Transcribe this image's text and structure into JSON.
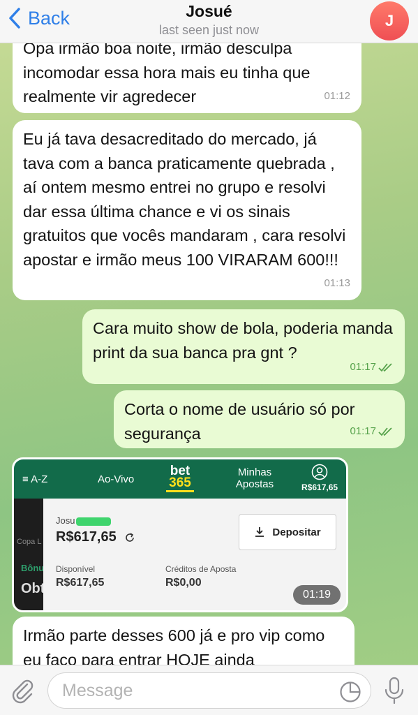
{
  "header": {
    "back_label": "Back",
    "contact_name": "Josué",
    "status": "last seen just now",
    "avatar_initial": "J"
  },
  "messages": [
    {
      "direction": "in",
      "text": "Opa irmão boa noite, irmão desculpa incomodar essa hora mais eu tinha que realmente vir agredecer",
      "time": "01:12"
    },
    {
      "direction": "in",
      "text": "Eu já tava desacreditado do mercado, já tava com a banca praticamente quebrada , aí ontem mesmo entrei no grupo e resolvi dar essa última chance e vi os sinais gratuitos que vocês mandaram , cara resolvi apostar e irmão meus 100 VIRARAM 600!!!",
      "time": "01:13"
    },
    {
      "direction": "out",
      "text": "Cara muito show de bola, poderia manda print da sua banca pra gnt ?",
      "time": "01:17"
    },
    {
      "direction": "out",
      "text": "Corta o nome de usuário só por segurança",
      "time": "01:17"
    },
    {
      "direction": "in",
      "type": "image",
      "time": "01:19"
    },
    {
      "direction": "in",
      "text": "Irmão parte desses 600 já e pro vip como eu faço para entrar HOJE ainda",
      "time": ""
    }
  ],
  "screenshot": {
    "nav_az": "≡ A-Z",
    "nav_live": "Ao-Vivo",
    "logo_top": "bet",
    "logo_bottom": "365",
    "nav_my_bets": "Minhas Apostas",
    "nav_balance": "R$617,65",
    "side_copa": "Copa L",
    "side_bonus": "Bônu",
    "side_obt": "Obt",
    "account_name": "Josu",
    "balance": "R$617,65",
    "deposit_label": "Depositar",
    "available_label": "Disponível",
    "available_value": "R$617,65",
    "credits_label": "Créditos de Aposta",
    "credits_value": "R$0,00",
    "brand_green": "#126b4a",
    "brand_yellow": "#ffdf1b"
  },
  "composer": {
    "placeholder": "Message",
    "value": ""
  },
  "colors": {
    "incoming_bubble": "#ffffff",
    "outgoing_bubble": "#e9fbd4",
    "accent": "#2f7fe8",
    "check_green": "#56a24b"
  },
  "icons": [
    "chevron-left-icon",
    "double-check-icon",
    "paperclip-icon",
    "sticker-icon",
    "microphone-icon",
    "download-icon",
    "refresh-icon",
    "user-circle-icon"
  ]
}
